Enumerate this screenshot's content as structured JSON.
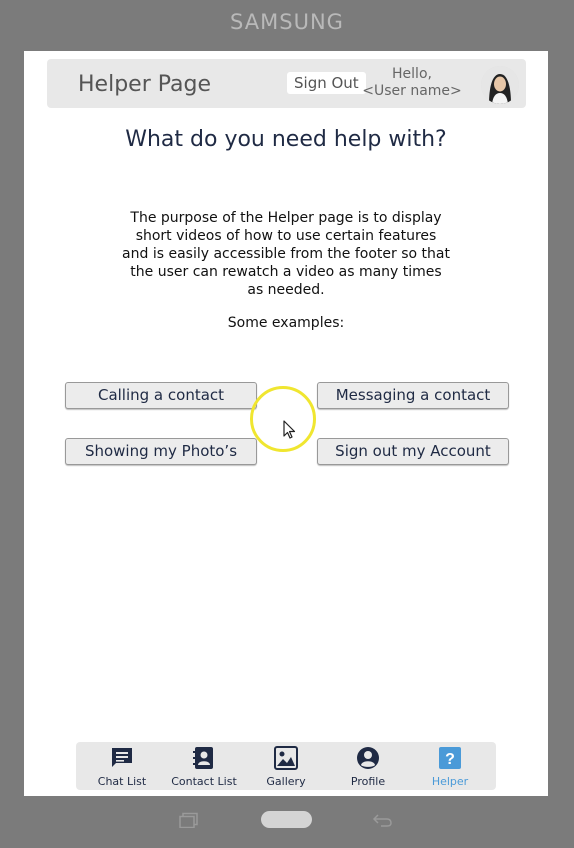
{
  "device": {
    "brand": "SAMSUNG"
  },
  "header": {
    "title": "Helper Page",
    "signout_label": "Sign Out",
    "greeting_line1": "Hello,",
    "greeting_line2": "<User name>"
  },
  "main": {
    "heading": "What do you need help with?",
    "description": "The purpose of the Helper page is to display short videos of how to use certain features and is easily accessible from the footer so that the user can rewatch a video as many times as needed.",
    "examples_label": "Some examples:",
    "buttons": [
      {
        "label": "Calling a contact"
      },
      {
        "label": "Messaging a contact"
      },
      {
        "label": "Showing my Photo’s"
      },
      {
        "label": "Sign out my Account"
      }
    ]
  },
  "footer": {
    "items": [
      {
        "label": "Chat List",
        "icon": "chat-icon"
      },
      {
        "label": "Contact List",
        "icon": "contacts-icon"
      },
      {
        "label": "Gallery",
        "icon": "gallery-icon"
      },
      {
        "label": "Profile",
        "icon": "profile-icon"
      },
      {
        "label": "Helper",
        "icon": "help-icon",
        "active": true
      }
    ]
  },
  "colors": {
    "accent": "#4a9ad8",
    "text_dark": "#1f2a44",
    "cursor_highlight": "#f0e630"
  }
}
